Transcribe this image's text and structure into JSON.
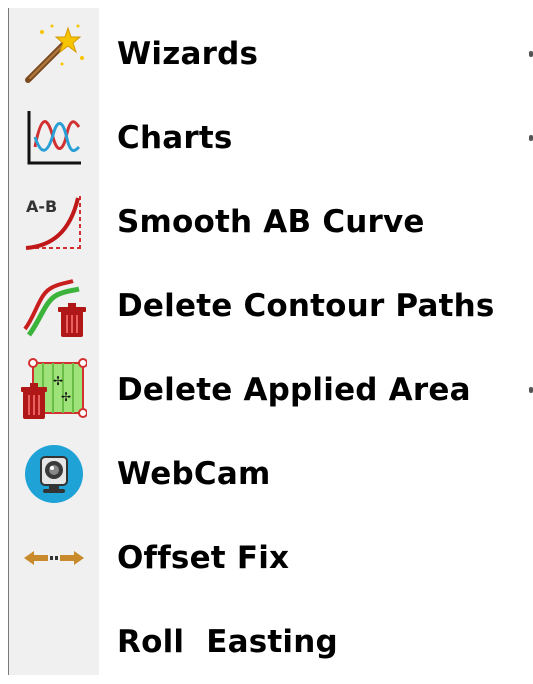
{
  "menu": {
    "items": [
      {
        "label": "Wizards",
        "icon": "magic-wand-icon",
        "has_submenu": true
      },
      {
        "label": "Charts",
        "icon": "chart-icon",
        "has_submenu": true
      },
      {
        "label": "Smooth AB Curve",
        "icon": "ab-curve-icon",
        "has_submenu": false
      },
      {
        "label": "Delete Contour Paths",
        "icon": "delete-contour-icon",
        "has_submenu": false
      },
      {
        "label": "Delete Applied Area",
        "icon": "delete-area-icon",
        "has_submenu": true
      },
      {
        "label": "WebCam",
        "icon": "webcam-icon",
        "has_submenu": false
      },
      {
        "label": "Offset Fix",
        "icon": "offset-arrows-icon",
        "has_submenu": false
      },
      {
        "label": "Roll  Easting",
        "icon": "",
        "has_submenu": false
      }
    ]
  }
}
